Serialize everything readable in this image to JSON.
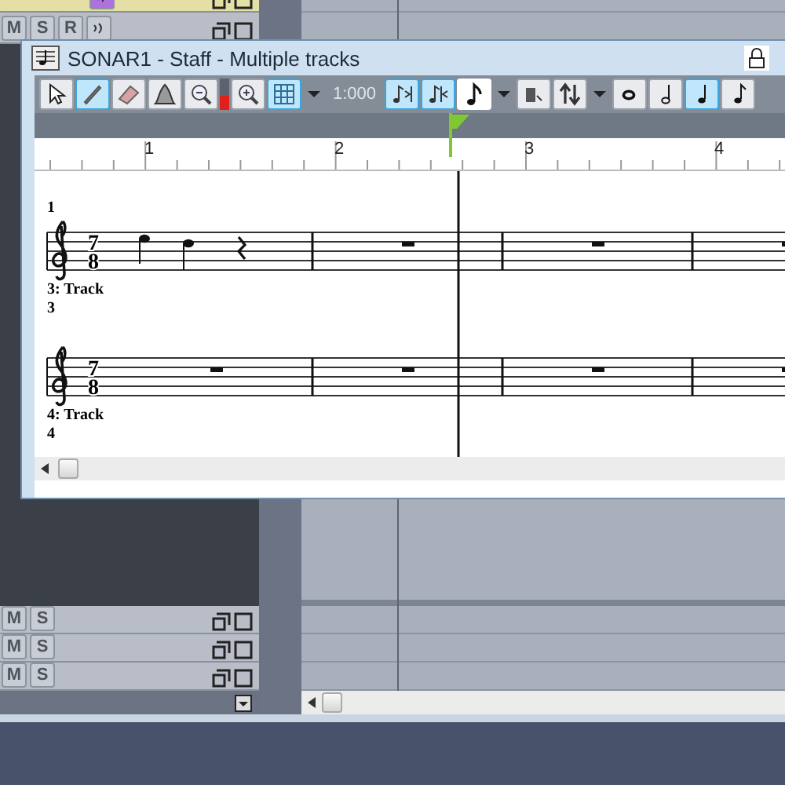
{
  "window": {
    "title": "SONAR1 - Staff - Multiple tracks"
  },
  "toolbar": [
    {
      "kind": "select",
      "selected": false
    },
    {
      "kind": "draw",
      "selected": true
    },
    {
      "kind": "erase",
      "selected": false
    },
    {
      "kind": "velocity",
      "selected": false
    },
    {
      "kind": "zoom-out",
      "selected": false
    },
    {
      "kind": "meter",
      "level": 0.45
    },
    {
      "kind": "zoom-in",
      "selected": false
    },
    {
      "kind": "grid",
      "selected": true
    },
    {
      "kind": "dropdown"
    },
    {
      "kind": "time",
      "text": "1:000"
    },
    {
      "kind": "snap-right",
      "selected": true
    },
    {
      "kind": "snap-left",
      "selected": true
    },
    {
      "kind": "duration"
    },
    {
      "kind": "dropdown"
    },
    {
      "kind": "fill",
      "selected": false
    },
    {
      "kind": "swap",
      "selected": false
    },
    {
      "kind": "dropdown"
    },
    {
      "kind": "whole-note",
      "selected": false
    },
    {
      "kind": "half-note",
      "selected": false
    },
    {
      "kind": "quarter-note",
      "selected": true
    },
    {
      "kind": "eighth-note",
      "selected": false
    }
  ],
  "ruler": [
    "1",
    "2",
    "3",
    "4"
  ],
  "staves": [
    {
      "measure_number": "1",
      "track_label": "3: Track",
      "track_number": "3",
      "time_signature": [
        "7",
        "8"
      ],
      "measures": [
        {
          "kind": "notes"
        },
        {
          "kind": "rest"
        },
        {
          "kind": "rest"
        },
        {
          "kind": "rest"
        }
      ]
    },
    {
      "track_label": "4: Track",
      "track_number": "4",
      "time_signature": [
        "7",
        "8"
      ],
      "measures": [
        {
          "kind": "rest"
        },
        {
          "kind": "rest"
        },
        {
          "kind": "rest"
        },
        {
          "kind": "rest"
        }
      ]
    }
  ],
  "tracks_top": [
    {
      "selected": true,
      "echo_on": true
    },
    {
      "selected": false,
      "buttons": [
        "M",
        "S",
        "R"
      ],
      "echo_on": false
    }
  ],
  "tracks_bottom": [
    {
      "buttons": [
        "M",
        "S"
      ]
    },
    {
      "buttons": [
        "M",
        "S"
      ]
    },
    {
      "buttons": [
        "M",
        "S"
      ]
    }
  ]
}
